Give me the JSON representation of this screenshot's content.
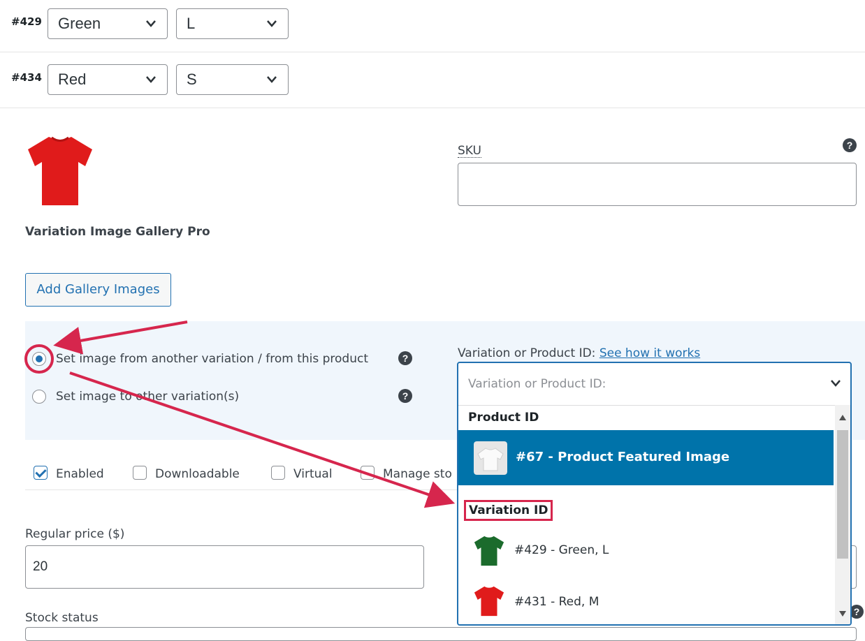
{
  "variations": [
    {
      "id": "#429",
      "color": "Green",
      "size": "L"
    },
    {
      "id": "#434",
      "color": "Red",
      "size": "S"
    }
  ],
  "sku": {
    "label": "SKU",
    "value": ""
  },
  "gallery": {
    "title": "Variation Image Gallery Pro",
    "add_button": "Add Gallery Images"
  },
  "image_options": {
    "opt1": "Set image from another variation / from this product",
    "opt2": "Set image to other variation(s)",
    "selected": 1
  },
  "variation_lookup": {
    "label": "Variation or Product ID:",
    "link": "See how it works",
    "placeholder": "Variation or Product ID:",
    "groups": [
      {
        "name": "Product ID",
        "options": [
          {
            "text": "#67 - Product Featured Image",
            "highlighted": true
          }
        ]
      },
      {
        "name": "Variation ID",
        "options": [
          {
            "text": "#429 - Green, L"
          },
          {
            "text": "#431 - Red, M"
          }
        ]
      }
    ]
  },
  "checkboxes": {
    "enabled": {
      "label": "Enabled",
      "checked": true
    },
    "downloadable": {
      "label": "Downloadable",
      "checked": false
    },
    "virtual": {
      "label": "Virtual",
      "checked": false
    },
    "manage_stock": {
      "label": "Manage sto",
      "checked": false
    }
  },
  "regular_price": {
    "label": "Regular price ($)",
    "value": "20"
  },
  "stock_status": {
    "label": "Stock status"
  },
  "colors": {
    "accent": "#2271b1",
    "annotation": "#d6264d",
    "highlight": "#0073aa",
    "panel": "#f0f6fc"
  }
}
